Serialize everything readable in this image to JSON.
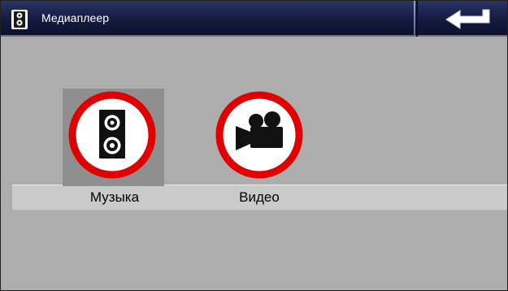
{
  "window": {
    "title": "Медиаплеер"
  },
  "menu": {
    "items": [
      {
        "label": "Музыка",
        "icon": "speaker-icon",
        "selected": true
      },
      {
        "label": "Видео",
        "icon": "movie-camera-icon",
        "selected": false
      }
    ]
  },
  "colors": {
    "titlebar": "#151b40",
    "background": "#adadad",
    "labels_band": "#cacaca",
    "selection": "#8f8f8f",
    "icon_ring": "#e10000"
  }
}
